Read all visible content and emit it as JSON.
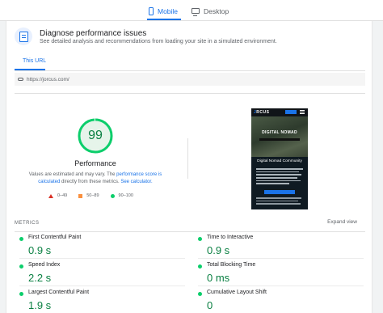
{
  "tabs": {
    "mobile": "Mobile",
    "desktop": "Desktop",
    "active": "Mobile"
  },
  "diagnose": {
    "title": "Diagnose performance issues",
    "subtitle": "See detailed analysis and recommendations from loading your site in a simulated environment."
  },
  "url_section": {
    "tab_label": "This URL",
    "url": "https://jorcus.com/"
  },
  "performance": {
    "score": "99",
    "label": "Performance",
    "note_prefix": "Values are estimated and may vary. The ",
    "note_link1": "performance score is calculated",
    "note_middle": " directly from these metrics. ",
    "note_link2": "See calculator.",
    "note_suffix": "",
    "score_fraction": 0.99,
    "ring_color": "#0cce6b"
  },
  "legend": {
    "poor": "0–49",
    "average": "50–89",
    "good": "90–100"
  },
  "screenshot": {
    "logo_prefix": "J",
    "logo_rest": "RCUS",
    "hero_title": "DIGITAL NOMAD",
    "heading": "Digital Nomad Community"
  },
  "metrics": {
    "title": "METRICS",
    "expand_label": "Expand view",
    "items": [
      {
        "label": "First Contentful Paint",
        "value": "0.9 s"
      },
      {
        "label": "Time to Interactive",
        "value": "0.9 s"
      },
      {
        "label": "Speed Index",
        "value": "2.2 s"
      },
      {
        "label": "Total Blocking Time",
        "value": "0 ms"
      },
      {
        "label": "Largest Contentful Paint",
        "value": "1.9 s"
      },
      {
        "label": "Cumulative Layout Shift",
        "value": "0"
      }
    ]
  }
}
